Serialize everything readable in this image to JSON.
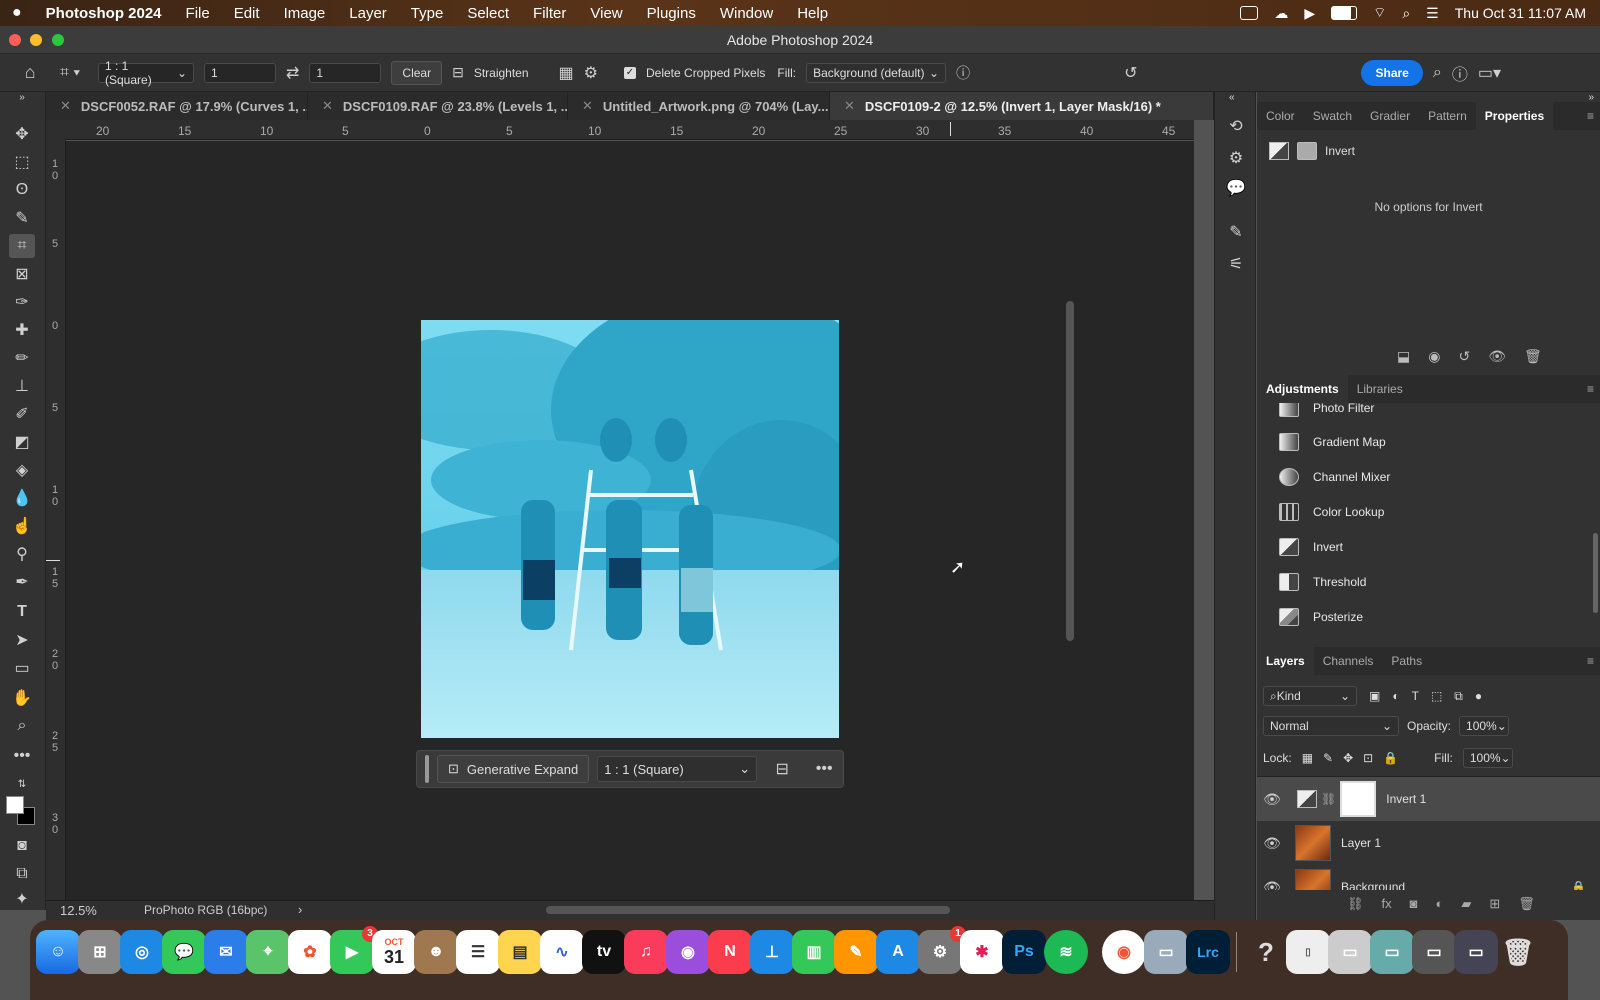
{
  "menubar": {
    "apple_icon": "apple-icon",
    "app": "Photoshop 2024",
    "items": [
      "File",
      "Edit",
      "Image",
      "Layer",
      "Type",
      "Select",
      "Filter",
      "View",
      "Plugins",
      "Window",
      "Help"
    ],
    "clock": "Thu Oct 31  11:07 AM"
  },
  "window": {
    "title": "Adobe Photoshop 2024"
  },
  "options": {
    "ratio": "1 : 1 (Square)",
    "width": "1",
    "height": "1",
    "clear": "Clear",
    "straighten": "Straighten",
    "delete_cropped": "Delete Cropped Pixels",
    "fill_label": "Fill:",
    "fill_value": "Background (default)",
    "share": "Share"
  },
  "tabs": [
    {
      "label": "DSCF0052.RAF @ 17.9% (Curves 1, ..."
    },
    {
      "label": "DSCF0109.RAF @ 23.8% (Levels 1, ..."
    },
    {
      "label": "Untitled_Artwork.png @ 704% (Lay..."
    },
    {
      "label": "DSCF0109-2 @ 12.5% (Invert 1, Layer Mask/16) *"
    }
  ],
  "ruler": {
    "h": [
      "20",
      "15",
      "10",
      "5",
      "0",
      "5",
      "10",
      "15",
      "20",
      "25",
      "30",
      "35",
      "40",
      "45"
    ],
    "v": [
      "1\n0",
      "5",
      "0",
      "5",
      "1\n0",
      "1\n5",
      "2\n0",
      "2\n5",
      "3\n0"
    ]
  },
  "context_bar": {
    "generative_expand": "Generative Expand",
    "ratio": "1 : 1 (Square)"
  },
  "status": {
    "zoom": "12.5%",
    "profile": "ProPhoto RGB (16bpc)"
  },
  "properties": {
    "tabs": [
      "Color",
      "Swatch",
      "Gradier",
      "Pattern",
      "Properties"
    ],
    "title": "Invert",
    "message": "No options for Invert"
  },
  "adjustments": {
    "tabs": [
      "Adjustments",
      "Libraries"
    ],
    "items": [
      "Photo Filter",
      "Gradient Map",
      "Channel Mixer",
      "Color Lookup",
      "Invert",
      "Threshold",
      "Posterize"
    ]
  },
  "layers": {
    "tabs": [
      "Layers",
      "Channels",
      "Paths"
    ],
    "kind": "Kind",
    "blend": "Normal",
    "opacity_label": "Opacity:",
    "opacity": "100%",
    "lock_label": "Lock:",
    "fill_label": "Fill:",
    "fill": "100%",
    "rows": [
      {
        "name": "Invert 1"
      },
      {
        "name": "Layer 1"
      },
      {
        "name": "Background"
      }
    ]
  },
  "dock": {
    "facetime_badge": "3",
    "calendar_month": "OCT",
    "calendar_day": "31",
    "settings_badge": "1",
    "tv_label": "tv",
    "ps_label": "Ps",
    "lrc_label": "Lrc"
  },
  "colors": {
    "accent": "#1473e6",
    "panel": "#323232",
    "canvas": "#262626"
  }
}
